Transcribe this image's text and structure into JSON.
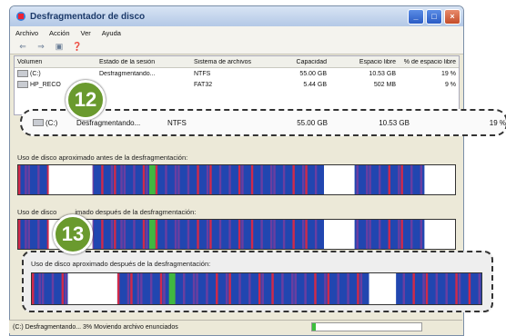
{
  "window": {
    "title": "Desfragmentador de disco"
  },
  "menu": [
    "Archivo",
    "Acción",
    "Ver",
    "Ayuda"
  ],
  "toolbar": {
    "icons": [
      "back-icon",
      "forward-icon",
      "properties-icon",
      "help-icon"
    ]
  },
  "table": {
    "headers": [
      "Volumen",
      "Estado de la sesión",
      "Sistema de archivos",
      "Capacidad",
      "Espacio libre",
      "% de espacio libre"
    ],
    "rows": [
      [
        "(C:)",
        "Desfragmentando...",
        "NTFS",
        "55.00 GB",
        "10.53 GB",
        "19 %"
      ],
      [
        "HP_RECO",
        "",
        "FAT32",
        "5.44 GB",
        "502 MB",
        "9 %"
      ]
    ]
  },
  "highlight_row": [
    "(C:)",
    "Desfragmentando...",
    "NTFS",
    "55.00 GB",
    "10.53 GB",
    "19 %"
  ],
  "badges": {
    "first": "12",
    "second": "13"
  },
  "labels": {
    "before": "Uso de disco aproximado antes de la desfragmentación:",
    "after": "Uso de disco aproximado después de la desfragmentación:",
    "after_partial": "Uso de disco",
    "after_partial2": "imado después de la desfragmentación:"
  },
  "status": {
    "text": "(C:) Desfragmentando... 3% Moviendo archivo enunciados",
    "progress": 0.03
  },
  "colors": {
    "used": "#2146b0",
    "fragmented": "#d02a4a",
    "contiguous": "#2b6fd0",
    "system": "#40b840",
    "free": "#ffffff"
  }
}
